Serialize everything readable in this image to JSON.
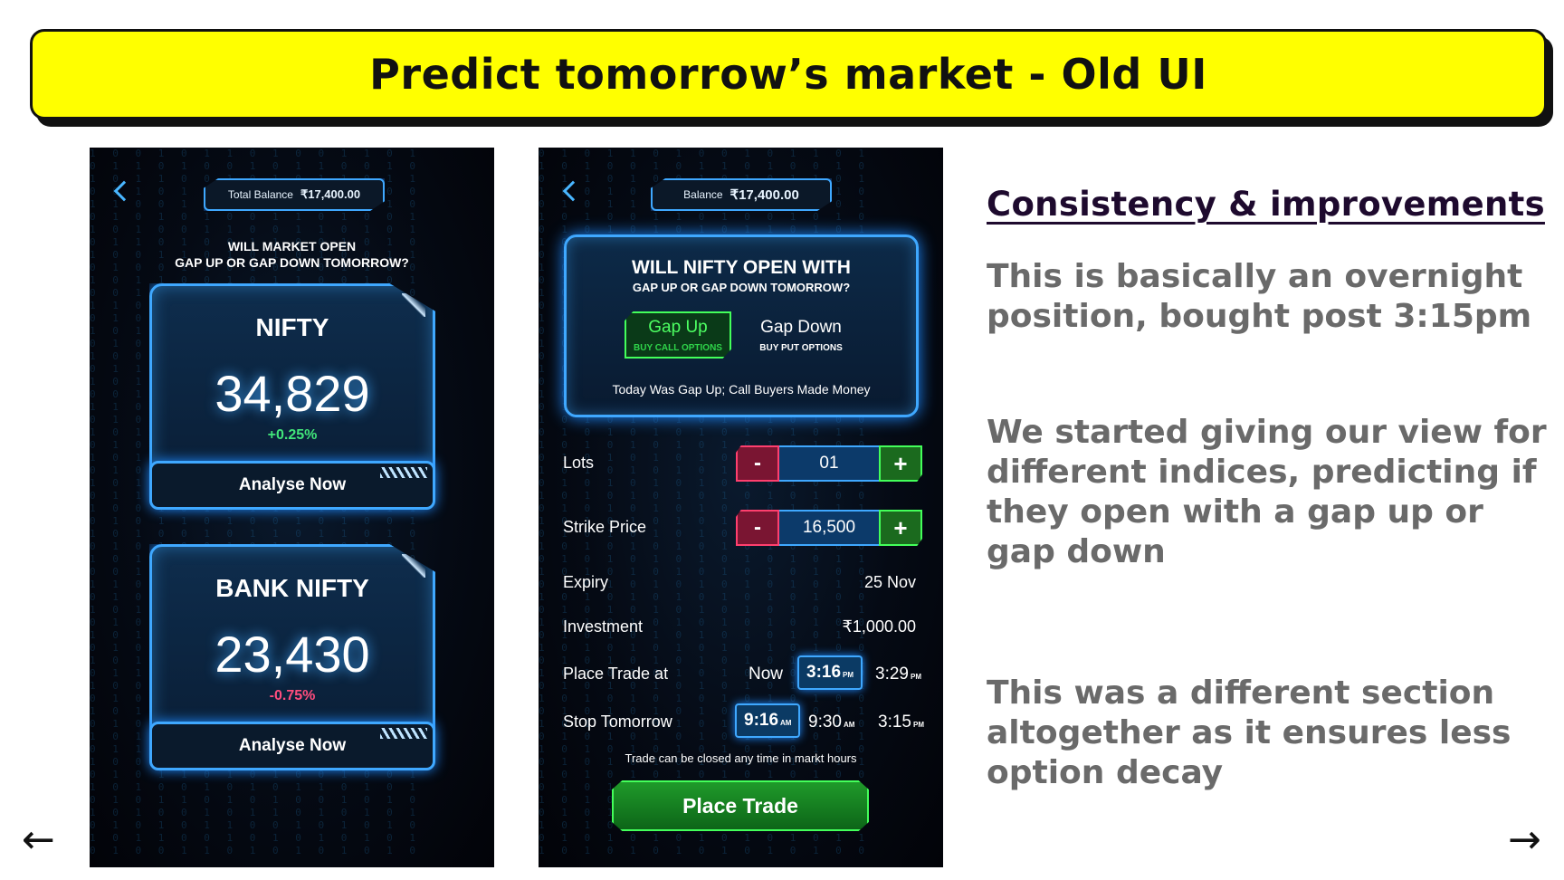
{
  "banner": {
    "title": "Predict tomorrow’s market - Old UI"
  },
  "phone1": {
    "balance_label": "Total Balance",
    "balance_amount": "₹17,400.00",
    "question_line1": "WILL MARKET OPEN",
    "question_line2": "GAP UP OR GAP DOWN TOMORROW?",
    "cards": [
      {
        "name": "NIFTY",
        "value": "34,829",
        "change": "+0.25%",
        "change_color": "#41e57a",
        "button_label": "Analyse Now"
      },
      {
        "name": "BANK NIFTY",
        "value": "23,430",
        "change": "-0.75%",
        "change_color": "#ff4d7d",
        "button_label": "Analyse Now"
      }
    ]
  },
  "phone2": {
    "balance_label": "Balance",
    "balance_amount": "₹17,400.00",
    "question_line1": "WILL NIFTY OPEN WITH",
    "question_line2": "GAP UP OR GAP DOWN TOMORROW?",
    "gap_up": {
      "label": "Gap Up",
      "sub": "BUY CALL OPTIONS"
    },
    "gap_down": {
      "label": "Gap Down",
      "sub": "BUY PUT OPTIONS"
    },
    "today_note": "Today Was Gap Up; Call Buyers Made Money",
    "lots": {
      "label": "Lots",
      "value": "01",
      "minus": "-",
      "plus": "+"
    },
    "strike": {
      "label": "Strike Price",
      "value": "16,500",
      "minus": "-",
      "plus": "+"
    },
    "expiry": {
      "label": "Expiry",
      "value": "25 Nov"
    },
    "investment": {
      "label": "Investment",
      "value": "₹1,000.00"
    },
    "place_trade_at": {
      "label": "Place Trade at",
      "options": [
        "Now",
        "3:16",
        "3:29"
      ],
      "ampm": [
        "",
        "PM",
        "PM"
      ],
      "selected": "3:16"
    },
    "stop_tomorrow": {
      "label": "Stop Tomorrow",
      "options": [
        "9:16",
        "9:30",
        "3:15"
      ],
      "ampm": [
        "AM",
        "AM",
        "PM"
      ],
      "selected": "9:16"
    },
    "closed_note": "Trade can be closed any time in markt hours",
    "place_button": "Place Trade"
  },
  "notes": {
    "heading": "Consistency & improvements",
    "para1": "This is basically an overnight position, bought post 3:15pm",
    "para2": "We started giving our view for different indices, predicting if they open with a gap up or gap down",
    "para3": "This was a different section altogether as it ensures less option decay"
  },
  "nav": {
    "prev": "←",
    "next": "→"
  },
  "colors": {
    "banner_bg": "#ffff00",
    "neon_blue": "#3fa8ff",
    "neon_green": "#43ff5a",
    "neon_red": "#ff3f6e"
  }
}
